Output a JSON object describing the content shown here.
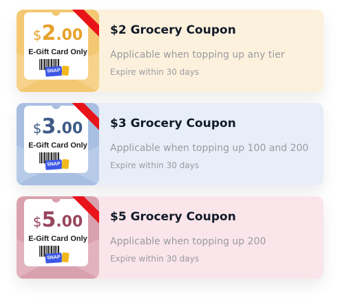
{
  "coupons": [
    {
      "currency": "$",
      "whole": "2",
      "decimal": ".00",
      "gift_label": "E-Gift Card Only",
      "brand": "SNAP",
      "title": "$2 Grocery Coupon",
      "description": "Applicable when topping up any tier",
      "expire": "Expire within 30 days",
      "card_bg": "#fcf1dc",
      "thumb_bg": "#f4c873",
      "envelope_top": "#f7d28a",
      "amount_color": "#e6a22c"
    },
    {
      "currency": "$",
      "whole": "3",
      "decimal": ".00",
      "gift_label": "E-Gift Card Only",
      "brand": "SNAP",
      "title": "$3 Grocery Coupon",
      "description": "Applicable when topping up 100 and 200",
      "expire": "Expire within 30 days",
      "card_bg": "#e8eef8",
      "thumb_bg": "#a8bfe2",
      "envelope_top": "#b7cbe9",
      "amount_color": "#3e5a86"
    },
    {
      "currency": "$",
      "whole": "5",
      "decimal": ".00",
      "gift_label": "E-Gift Card Only",
      "brand": "SNAP",
      "title": "$5 Grocery Coupon",
      "description": "Applicable when topping up 200",
      "expire": "Expire within 30 days",
      "card_bg": "#f9e5ea",
      "thumb_bg": "#d9a1ae",
      "envelope_top": "#e2b3bf",
      "amount_color": "#97475e"
    }
  ]
}
